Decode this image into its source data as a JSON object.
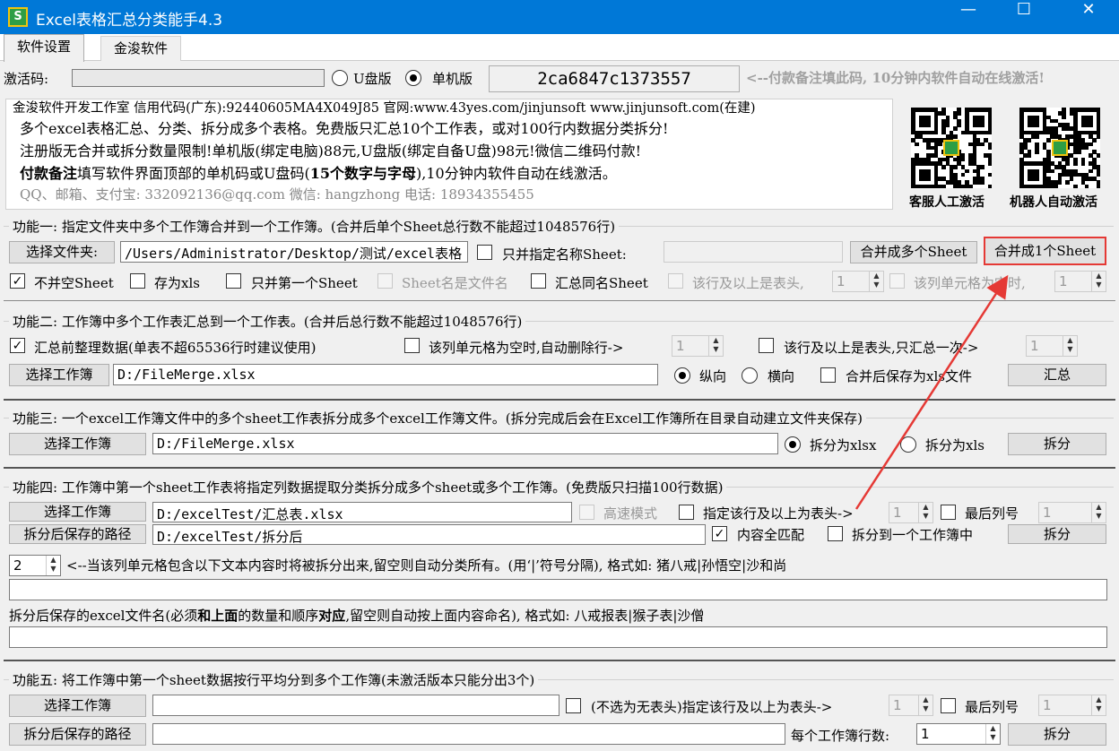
{
  "window": {
    "title": "Excel表格汇总分类能手4.3",
    "icon_text": "S"
  },
  "tabs": [
    "软件设置",
    "金浚软件"
  ],
  "activation": {
    "label": "激活码:",
    "radio_u": "U盘版",
    "radio_pc": "单机版",
    "machine_code": "2ca6847c1373557",
    "note": "<--付款备注填此码, 10分钟内软件自动在线激活!"
  },
  "info": {
    "company": "金浚软件开发工作室  信用代码(广东):92440605MA4X049J85  官网:www.43yes.com/jinjunsoft  www.jinjunsoft.com(在建)",
    "line1": "多个excel表格汇总、分类、拆分成多个表格。免费版只汇总10个工作表，或对100行内数据分类拆分!",
    "line2": "注册版无合并或拆分数量限制!单机版(绑定电脑)88元,U盘版(绑定自备U盘)98元!微信二维码付款!",
    "line3_bold": "付款备注",
    "line3_rest": "填写软件界面顶部的单机码或U盘码(",
    "line3_bold2": "15个数字与字母",
    "line3_end": "),10分钟内软件自动在线激活。",
    "contact": "QQ、邮箱、支付宝: 332092136@qq.com   微信: hangzhong   电话: 18934355455",
    "qr1_caption": "客服人工激活",
    "qr2_caption": "机器人自动激活"
  },
  "f1": {
    "title": "功能一: 指定文件夹中多个工作簿合并到一个工作簿。(合并后单个Sheet总行数不能超过1048576行)",
    "choose_btn": "选择文件夹:",
    "path": "/Users/Administrator/Desktop/测试/excel表格",
    "only_named": "只并指定名称Sheet:",
    "merge_multi": "合并成多个Sheet",
    "merge_one": "合并成1个Sheet",
    "cb_no_empty": "不并空Sheet",
    "cb_xls": "存为xls",
    "cb_first": "只并第一个Sheet",
    "cb_name_file": "Sheet名是文件名",
    "cb_same_name": "汇总同名Sheet",
    "cb_header": "该行及以上是表头,",
    "header_val": "1",
    "cb_empty_cell": "该列单元格为空时,",
    "empty_val": "1"
  },
  "f2": {
    "title": "功能二: 工作簿中多个工作表汇总到一个工作表。(合并后总行数不能超过1048576行)",
    "cb_tidy": "汇总前整理数据(单表不超65536行时建议使用)",
    "cb_del": "该列单元格为空时,自动删除行->",
    "del_val": "1",
    "cb_header": "该行及以上是表头,只汇总一次->",
    "header_val": "1",
    "choose_btn": "选择工作簿",
    "path": "D:/FileMerge.xlsx",
    "r_v": "纵向",
    "r_h": "横向",
    "cb_save_xls": "合并后保存为xls文件",
    "run": "汇总"
  },
  "f3": {
    "title": "功能三: 一个excel工作簿文件中的多个sheet工作表拆分成多个excel工作簿文件。(拆分完成后会在Excel工作簿所在目录自动建立文件夹保存)",
    "choose_btn": "选择工作簿",
    "path": "D:/FileMerge.xlsx",
    "r_xlsx": "拆分为xlsx",
    "r_xls": "拆分为xls",
    "run": "拆分"
  },
  "f4": {
    "title": "功能四: 工作簿中第一个sheet工作表将指定列数据提取分类拆分成多个sheet或多个工作簿。(免费版只扫描100行数据)",
    "choose_btn": "选择工作簿",
    "path": "D:/excelTest/汇总表.xlsx",
    "cb_fast": "高速模式",
    "cb_header": "指定该行及以上为表头->",
    "header_val": "1",
    "cb_lastcol": "最后列号",
    "lastcol_val": "1",
    "save_btn": "拆分后保存的路径",
    "save_path": "D:/excelTest/拆分后",
    "cb_full": "内容全匹配",
    "cb_one_book": "拆分到一个工作簿中",
    "run": "拆分",
    "col_val": "2",
    "col_note": "<--当该列单元格包含以下文本内容时将被拆分出来,留空则自动分类所有。(用‘|’符号分隔), 格式如: 猪八戒|孙悟空|沙和尚",
    "name_a": "拆分后保存的excel文件名(必须",
    "name_b": "和上面",
    "name_c": "的数量和顺序",
    "name_d": "对应",
    "name_e": ",留空则自动按上面内容命名), 格式如: 八戒报表|猴子表|沙僧"
  },
  "f5": {
    "title": "功能五: 将工作簿中第一个sheet数据按行平均分到多个工作簿(未激活版本只能分出3个)",
    "choose_btn": "选择工作簿",
    "cb_header": "(不选为无表头)指定该行及以上为表头->",
    "header_val": "1",
    "cb_lastcol": "最后列号",
    "lastcol_val": "1",
    "save_btn": "拆分后保存的路径",
    "rows_label": "每个工作簿行数:",
    "rows_val": "1",
    "run": "拆分"
  },
  "colors": {
    "titlebar": "#0078d7",
    "highlight": "#e53935",
    "arrow": "#e53935"
  }
}
